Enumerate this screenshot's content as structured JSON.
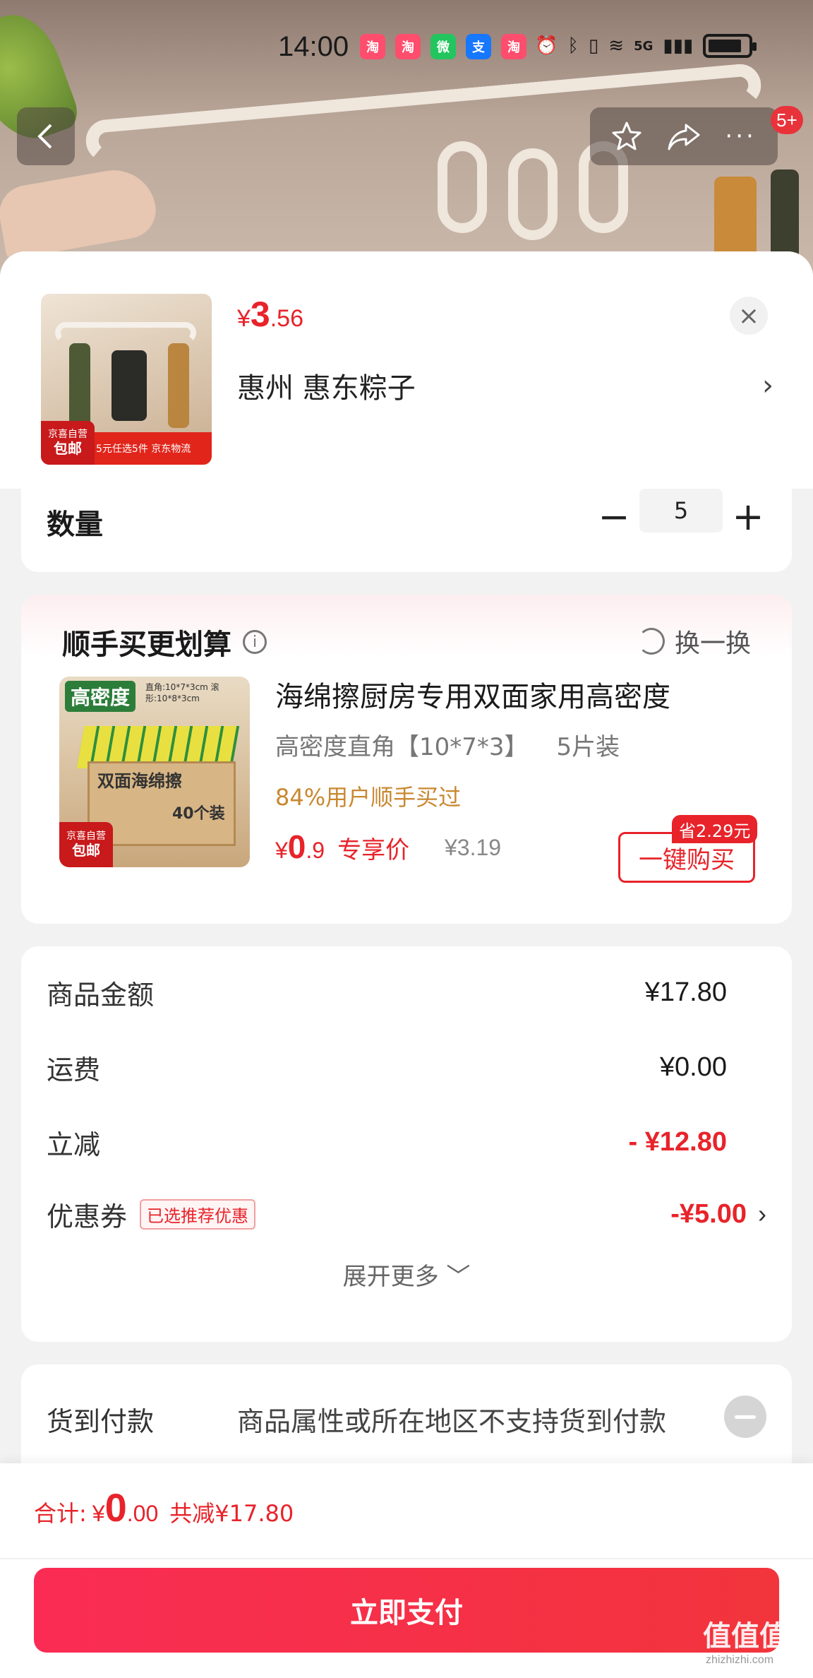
{
  "status_bar": {
    "time": "14:00",
    "network": "5G",
    "battery_fraction": 0.85,
    "apps": [
      {
        "icon": "taobao-icon",
        "color": "#ff4d6d",
        "glyph": "淘"
      },
      {
        "icon": "taobao-icon",
        "color": "#ff4d6d",
        "glyph": "淘"
      },
      {
        "icon": "wechat-icon",
        "color": "#22c55e",
        "glyph": "微"
      },
      {
        "icon": "alipay-icon",
        "color": "#1677ff",
        "glyph": "支"
      },
      {
        "icon": "taobao-icon",
        "color": "#ff4d6d",
        "glyph": "淘"
      }
    ]
  },
  "nav": {
    "back_icon": "chevron-left-icon",
    "actions": [
      "star-icon",
      "share-icon",
      "more-icon"
    ],
    "message_badge": "5+"
  },
  "product": {
    "price_currency": "¥",
    "price_int": "3",
    "price_dec": ".56",
    "address": "惠州  惠东粽子",
    "thumb_footer": "5元任选5件 京东物流",
    "thumb_tag_top": "京喜自营",
    "thumb_tag_bottom": "包邮"
  },
  "quantity": {
    "label": "数量",
    "minus": "−",
    "value": "5",
    "plus": "+"
  },
  "recommend": {
    "title": "顺手买更划算",
    "swap_label": "换一换",
    "item": {
      "name": "海绵擦厨房专用双面家用高密度",
      "spec": "高密度直角【10*7*3】",
      "pack": "5片装",
      "bought_text": "84%用户顺手买过",
      "price_currency": "¥",
      "price_int": "0",
      "price_dec": ".9",
      "exclusive_label": "专享价",
      "original_price": "¥3.19",
      "buy_label": "一键购买",
      "save_badge": "省2.29元",
      "img_head": "高密度",
      "img_size": "直角:10*7*3cm 滚形:10*8*3cm",
      "img_box_title": "双面海绵擦",
      "img_box_count": "40个装",
      "img_tag_top": "京喜自营",
      "img_tag_bottom": "包邮"
    }
  },
  "summary": {
    "rows": [
      {
        "label": "商品金额",
        "value": "¥17.80"
      },
      {
        "label": "运费",
        "value": "¥0.00"
      },
      {
        "label": "立减",
        "value": "- ¥12.80"
      },
      {
        "label": "优惠券",
        "tag": "已选推荐优惠",
        "value": "-¥5.00"
      }
    ],
    "expand_label": "展开更多 ﹀"
  },
  "cod": {
    "label": "货到付款",
    "desc": "商品属性或所在地区不支持货到付款"
  },
  "footer": {
    "total_label": "合计:",
    "total_currency": "¥",
    "total_int": "0",
    "total_dec": ".00",
    "saved": "共减¥17.80",
    "pay_label": "立即支付"
  },
  "watermark": {
    "text": "值值值",
    "sub": "zhizhizhi.com"
  },
  "colors": {
    "accent_red": "#e8232a",
    "pay_gradient_start": "#fa2c54",
    "pay_gradient_end": "#f2343c",
    "bought_orange": "#c88830"
  }
}
